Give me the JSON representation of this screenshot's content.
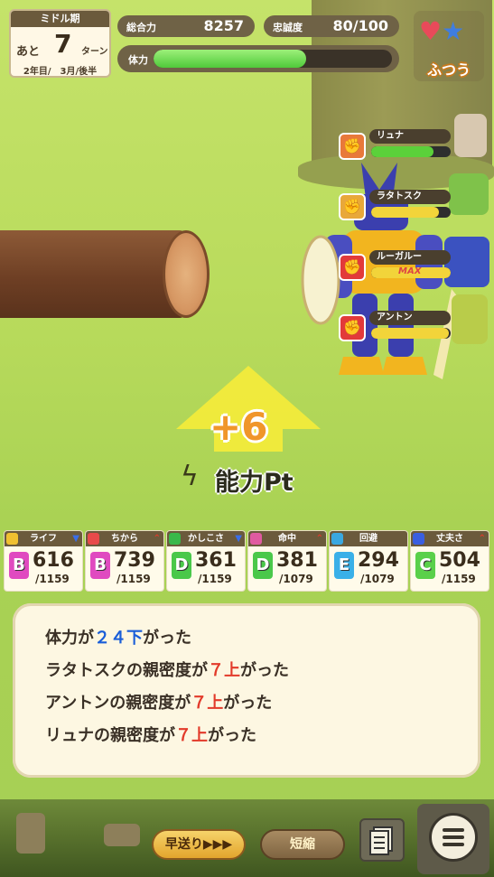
{
  "turn": {
    "phase": "ミドル期",
    "ato": "あと",
    "remaining": "7",
    "turn_label": "ターン",
    "date": "2年目/　3月/後半"
  },
  "header": {
    "total_power_label": "総合力",
    "total_power": "8257",
    "loyalty_label": "忠誠度",
    "loyalty": "80/100",
    "stamina_label": "体力",
    "stamina_fraction": 0.64
  },
  "mood": {
    "label": "ふつう",
    "icons": [
      "heart-icon",
      "star-icon"
    ]
  },
  "partners": [
    {
      "name": "リュナ",
      "badge_color": "#e8793a",
      "fill": 0.78,
      "fill_color": "#5bd13a",
      "max_text": ""
    },
    {
      "name": "ラタトスク",
      "badge_color": "#e8a83a",
      "fill": 0.85,
      "fill_color": "#f2d43a",
      "max_text": ""
    },
    {
      "name": "ルーガルー",
      "badge_color": "#e23a3a",
      "fill": 1.0,
      "fill_color": "#f2d43a",
      "max_text": "MAX"
    },
    {
      "name": "アントン",
      "badge_color": "#e23a3a",
      "fill": 0.98,
      "fill_color": "#f2d43a",
      "max_text": ""
    }
  ],
  "gain": {
    "amount": "+6",
    "label": "能力Pt"
  },
  "stats": [
    {
      "name": "ライフ",
      "color": "#f0c030",
      "arrow": "▼",
      "arrow_color": "#3a6ee8",
      "grade": "B",
      "grade_color": "#e04ac0",
      "value": "616",
      "max": "/1159"
    },
    {
      "name": "ちから",
      "color": "#e84a4a",
      "arrow": "⌃",
      "arrow_color": "#e23a2a",
      "grade": "B",
      "grade_color": "#e04ac0",
      "value": "739",
      "max": "/1159"
    },
    {
      "name": "かしこさ",
      "color": "#3ab84a",
      "arrow": "▼",
      "arrow_color": "#3a6ee8",
      "grade": "D",
      "grade_color": "#4ac84a",
      "value": "361",
      "max": "/1159"
    },
    {
      "name": "命中",
      "color": "#e05aa0",
      "arrow": "⌃",
      "arrow_color": "#e23a2a",
      "grade": "D",
      "grade_color": "#4ac84a",
      "value": "381",
      "max": "/1079"
    },
    {
      "name": "回避",
      "color": "#3aa8e0",
      "arrow": "",
      "arrow_color": "#e23a2a",
      "grade": "E",
      "grade_color": "#3ab0e8",
      "value": "294",
      "max": "/1079"
    },
    {
      "name": "丈夫さ",
      "color": "#3a5ee0",
      "arrow": "⌃",
      "arrow_color": "#e23a2a",
      "grade": "C",
      "grade_color": "#5ad04a",
      "value": "504",
      "max": "/1159"
    }
  ],
  "log": [
    {
      "before": "体力が",
      "highlight": "２４下",
      "after": "がった",
      "color": "#1a5ed8"
    },
    {
      "before": "ラタトスクの親密度が",
      "highlight": "７上",
      "after": "がった",
      "color": "#e23a2a"
    },
    {
      "before": "アントンの親密度が",
      "highlight": "７上",
      "after": "がった",
      "color": "#e23a2a"
    },
    {
      "before": "リュナの親密度が",
      "highlight": "７上",
      "after": "がった",
      "color": "#e23a2a"
    }
  ],
  "bottom": {
    "fast_forward": "早送り▶▶▶",
    "shorten": "短縮"
  }
}
